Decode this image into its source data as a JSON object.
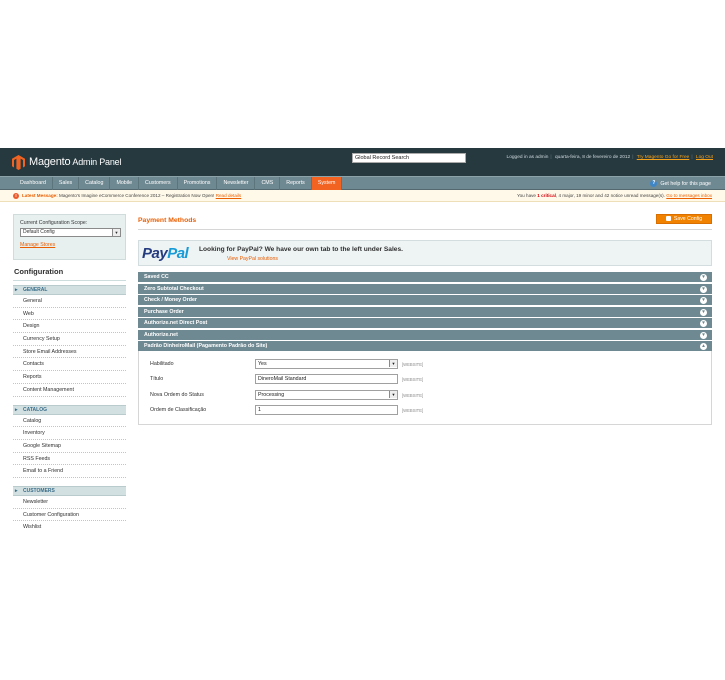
{
  "header": {
    "logo_word": "Magento",
    "logo_sub": "Admin Panel",
    "search_value": "Global Record Search",
    "logged_in": "Logged in as admin",
    "date": "quarta-feira, 8 de fevereiro de 2012",
    "try_link": "Try Magento Go for Free",
    "logout": "Log Out"
  },
  "nav": {
    "items": [
      "Dashboard",
      "Sales",
      "Catalog",
      "Mobile",
      "Customers",
      "Promotions",
      "Newsletter",
      "CMS",
      "Reports",
      "System"
    ],
    "active_index": 9,
    "help": "Get help for this page"
  },
  "messages": {
    "latest_label": "Latest Message:",
    "latest_text": "Magento's Imagine eCommerce Conference 2012 – Registration Now Open!",
    "latest_link": "Read details",
    "summary_prefix": "You have",
    "critical": "1 critical",
    "major": "4 major",
    "minor": "19 minor",
    "notice": "42 notice unread message(s).",
    "inbox_link": "Go to messages inbox"
  },
  "sidebar": {
    "scope_label": "Current Configuration Scope:",
    "scope_value": "Default Config",
    "manage_stores": "Manage Stores",
    "config_title": "Configuration",
    "groups": [
      {
        "title": "GENERAL",
        "items": [
          "General",
          "Web",
          "Design",
          "Currency Setup",
          "Store Email Addresses",
          "Contacts",
          "Reports",
          "Content Management"
        ]
      },
      {
        "title": "CATALOG",
        "items": [
          "Catalog",
          "Inventory",
          "Google Sitemap",
          "RSS Feeds",
          "Email to a Friend"
        ]
      },
      {
        "title": "CUSTOMERS",
        "items": [
          "Newsletter",
          "Customer Configuration",
          "Wishlist"
        ]
      }
    ]
  },
  "main": {
    "title": "Payment Methods",
    "save_label": "Save Config",
    "paypal_pay": "Pay",
    "paypal_pal": "Pal",
    "paypal_title": "Looking for PayPal? We have our own tab to the left under Sales.",
    "paypal_link": "View PayPal solutions",
    "sections": [
      "Saved CC",
      "Zero Subtotal Checkout",
      "Check / Money Order",
      "Purchase Order",
      "Authorize.net Direct Post",
      "Authorize.net",
      "Padrão DinheiroMail (Pagamento Padrão do Site)"
    ],
    "form": {
      "enabled_label": "Habilitado",
      "enabled_value": "Yes",
      "title_label": "Título",
      "title_value": "DineroMail Standard",
      "status_label": "Nova Ordem do Status",
      "status_value": "Processing",
      "sort_label": "Ordem de Classificação",
      "sort_value": "1",
      "scope_tag": "[WEBSITE]"
    }
  },
  "icons": {
    "logo": "magento-logo-icon",
    "help": "help-icon",
    "alert": "alert-icon",
    "toggle": "collapse-toggle-icon",
    "dropdown": "chevron-down-icon"
  },
  "colors": {
    "accent": "#eb5e00",
    "header_bg": "#26393f",
    "nav_bg": "#6f8992",
    "nav_active": "#f26322",
    "button": "#f18200"
  }
}
